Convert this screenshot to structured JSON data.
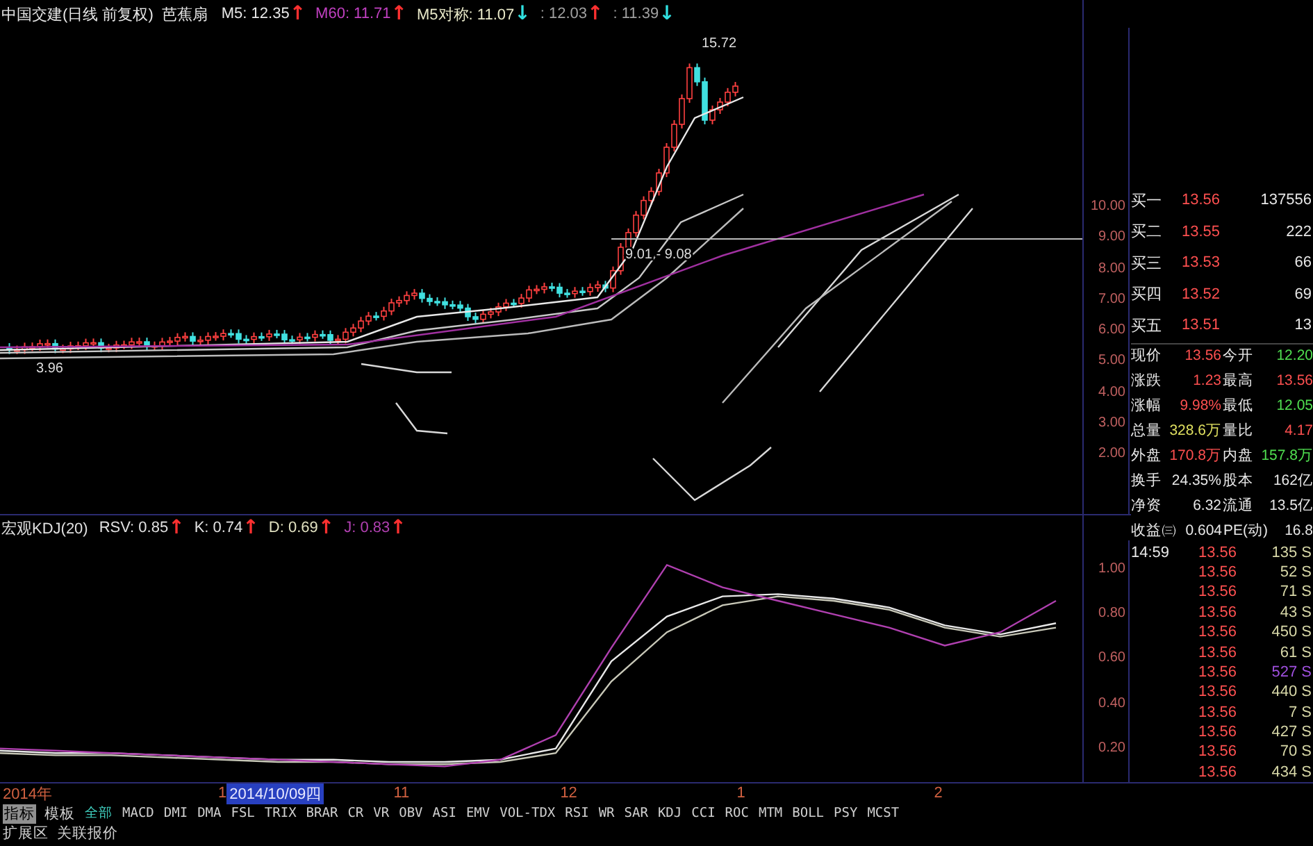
{
  "legend": {
    "title": "中国交建(日线 前复权)",
    "indicator": "芭蕉扇",
    "items": [
      {
        "label": "M5: 12.35",
        "color": "#e8e8e8",
        "arrow": {
          "text": "↑",
          "color": "#ff3030"
        }
      },
      {
        "label": "M60: 11.71",
        "color": "#c040c0",
        "arrow": {
          "text": "↑",
          "color": "#ff3030"
        }
      },
      {
        "label": "M5对称: 11.07",
        "color": "#e8e8c8",
        "arrow": {
          "text": "↓",
          "color": "#30e0e0"
        }
      },
      {
        "label": ": 12.03",
        "color": "#a0a0a0",
        "arrow": {
          "text": "↑",
          "color": "#ff3030"
        }
      },
      {
        "label": ": 11.39",
        "color": "#a0a0a0",
        "arrow": {
          "text": "↓",
          "color": "#30e0e0"
        }
      }
    ]
  },
  "price_chart": {
    "peak_label": "15.72",
    "low_label": "3.96",
    "range_label": "9.01 - 9.08",
    "y_axis_labels": [
      "10.00",
      "9.00",
      "8.00",
      "7.00",
      "6.00",
      "5.00",
      "4.00",
      "3.00",
      "2.00"
    ]
  },
  "kdj_chart": {
    "title": "宏观KDJ(20)",
    "items": [
      {
        "label": "RSV: 0.85",
        "color": "#e0e0e0",
        "arrow": {
          "text": "↑",
          "color": "#ff3030"
        }
      },
      {
        "label": "K: 0.74",
        "color": "#e0e0e0",
        "arrow": {
          "text": "↑",
          "color": "#ff3030"
        }
      },
      {
        "label": "D: 0.69",
        "color": "#e0e0c0",
        "arrow": {
          "text": "↑",
          "color": "#ff3030"
        }
      },
      {
        "label": "J: 0.83",
        "color": "#b040b0",
        "arrow": {
          "text": "↑",
          "color": "#ff3030"
        }
      }
    ],
    "chart_data": {
      "type": "line",
      "ylim": [
        0.05,
        1.13
      ],
      "yticks": [
        {
          "value": 1,
          "label": "1.00"
        },
        {
          "value": 0.8,
          "label": "0.80"
        },
        {
          "value": 0.6,
          "label": "0.60"
        },
        {
          "value": 0.4,
          "label": "0.40"
        },
        {
          "value": 0.2,
          "label": "0.20"
        }
      ],
      "series": [
        {
          "color": "#e8e8e8",
          "values": [
            0.19,
            0.18,
            0.18,
            0.17,
            0.16,
            0.15,
            0.15,
            0.14,
            0.14,
            0.15,
            0.2,
            0.59,
            0.79,
            0.88,
            0.89,
            0.87,
            0.83,
            0.75,
            0.71,
            0.76
          ]
        },
        {
          "color": "#c8c8b8",
          "values": [
            0.18,
            0.17,
            0.17,
            0.16,
            0.15,
            0.14,
            0.14,
            0.13,
            0.13,
            0.14,
            0.18,
            0.5,
            0.72,
            0.84,
            0.88,
            0.86,
            0.82,
            0.74,
            0.7,
            0.74
          ]
        },
        {
          "color": "#b040b0",
          "values": [
            0.2,
            0.19,
            0.18,
            0.17,
            0.16,
            0.15,
            0.14,
            0.13,
            0.12,
            0.15,
            0.26,
            0.65,
            1.02,
            0.92,
            0.86,
            0.8,
            0.74,
            0.66,
            0.72,
            0.86
          ]
        }
      ]
    }
  },
  "quote": {
    "bids": [
      {
        "label": "买一",
        "price": "13.56",
        "volume": "137556"
      },
      {
        "label": "买二",
        "price": "13.55",
        "volume": "222"
      },
      {
        "label": "买三",
        "price": "13.53",
        "volume": "66"
      },
      {
        "label": "买四",
        "price": "13.52",
        "volume": "69"
      },
      {
        "label": "买五",
        "price": "13.51",
        "volume": "13"
      }
    ],
    "stats": [
      {
        "label": "现价",
        "value": "13.56",
        "color": "#ff5050"
      },
      {
        "label": "今开",
        "value": "12.20",
        "color": "#50e050"
      },
      {
        "label": "涨跌",
        "value": "1.23",
        "color": "#ff5050"
      },
      {
        "label": "最高",
        "value": "13.56",
        "color": "#ff5050"
      },
      {
        "label": "涨幅",
        "value": "9.98%",
        "color": "#ff5050"
      },
      {
        "label": "最低",
        "value": "12.05",
        "color": "#50e050"
      },
      {
        "label": "总量",
        "value": "328.6万",
        "color": "#e0e060"
      },
      {
        "label": "量比",
        "value": "4.17",
        "color": "#ff5050"
      },
      {
        "label": "外盘",
        "value": "170.8万",
        "color": "#ff5050"
      },
      {
        "label": "内盘",
        "value": "157.8万",
        "color": "#50e050"
      },
      {
        "label": "换手",
        "value": "24.35%",
        "color": "#e8e8e8"
      },
      {
        "label": "股本",
        "value": "162亿",
        "color": "#e8e8e8"
      },
      {
        "label": "净资",
        "value": "6.32",
        "color": "#e8e8e8"
      },
      {
        "label": "流通",
        "value": "13.5亿",
        "color": "#e8e8e8"
      },
      {
        "label": "收益㈢",
        "value": "0.604",
        "color": "#e8e8e8"
      },
      {
        "label": "PE(动)",
        "value": "16.8",
        "color": "#e8e8e8"
      }
    ],
    "ticks": [
      {
        "time": "14:59",
        "price": "13.56",
        "volume": "135",
        "side": "S",
        "color": "#d8d8a8"
      },
      {
        "price": "13.56",
        "volume": "52",
        "side": "S",
        "color": "#d8d8a8"
      },
      {
        "price": "13.56",
        "volume": "71",
        "side": "S",
        "color": "#d8d8a8"
      },
      {
        "price": "13.56",
        "volume": "43",
        "side": "S",
        "color": "#d8d8a8"
      },
      {
        "price": "13.56",
        "volume": "450",
        "side": "S",
        "color": "#d8d8a8"
      },
      {
        "price": "13.56",
        "volume": "61",
        "side": "S",
        "color": "#d8d8a8"
      },
      {
        "price": "13.56",
        "volume": "527",
        "side": "S",
        "color": "#a050e0"
      },
      {
        "price": "13.56",
        "volume": "440",
        "side": "S",
        "color": "#d8d8a8"
      },
      {
        "price": "13.56",
        "volume": "7",
        "side": "S",
        "color": "#d8d8a8"
      },
      {
        "price": "13.56",
        "volume": "427",
        "side": "S",
        "color": "#d8d8a8"
      },
      {
        "price": "13.56",
        "volume": "70",
        "side": "S",
        "color": "#d8d8a8"
      },
      {
        "price": "13.56",
        "volume": "434",
        "side": "S",
        "color": "#d8d8a8"
      }
    ]
  },
  "time_axis": {
    "labels": [
      "2014年",
      "1",
      "11",
      "12",
      "1",
      "2"
    ],
    "cursor": "2014/10/09四"
  },
  "panel_tabs": [
    {
      "label": "指标",
      "selected": true
    },
    {
      "label": "模板",
      "selected": false
    }
  ],
  "indicator_tabs": [
    {
      "label": "全部",
      "selected": true
    },
    {
      "label": "MACD",
      "selected": false
    },
    {
      "label": "DMI",
      "selected": false
    },
    {
      "label": "DMA",
      "selected": false
    },
    {
      "label": "FSL",
      "selected": false
    },
    {
      "label": "TRIX",
      "selected": false
    },
    {
      "label": "BRAR",
      "selected": false
    },
    {
      "label": "CR",
      "selected": false
    },
    {
      "label": "VR",
      "selected": false
    },
    {
      "label": "OBV",
      "selected": false
    },
    {
      "label": "ASI",
      "selected": false
    },
    {
      "label": "EMV",
      "selected": false
    },
    {
      "label": "VOL-TDX",
      "selected": false
    },
    {
      "label": "RSI",
      "selected": false
    },
    {
      "label": "WR",
      "selected": false
    },
    {
      "label": "SAR",
      "selected": false
    },
    {
      "label": "KDJ",
      "selected": false
    },
    {
      "label": "CCI",
      "selected": false
    },
    {
      "label": "ROC",
      "selected": false
    },
    {
      "label": "MTM",
      "selected": false
    },
    {
      "label": "BOLL",
      "selected": false
    },
    {
      "label": "PSY",
      "selected": false
    },
    {
      "label": "MCST",
      "selected": false
    }
  ],
  "bottom_tabs": [
    "扩展区",
    "关联报价"
  ]
}
